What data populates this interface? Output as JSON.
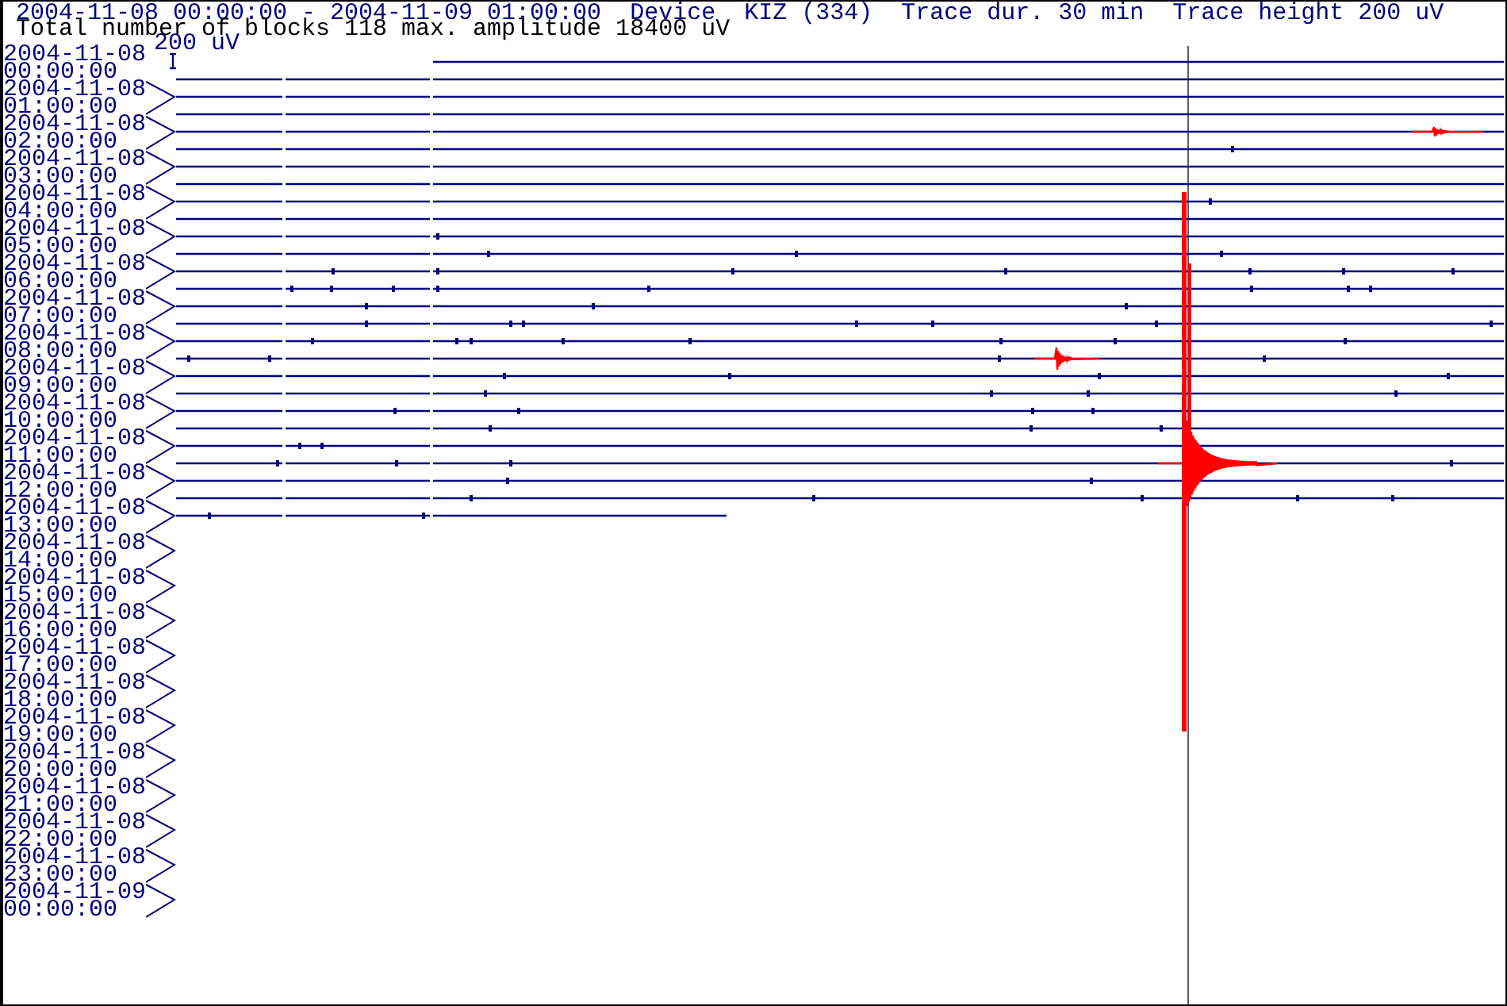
{
  "header": {
    "range": "2004-11-08 00:00:00 - 2004-11-09 01:00:00",
    "device": "Device  KIZ (334)",
    "trace_duration": "Trace dur. 30 min",
    "trace_height": "Trace height 200 uV",
    "summary": "Total number of blocks 118 max. amplitude 18400 uV"
  },
  "scale": {
    "label": "200 uV"
  },
  "time_labels": [
    {
      "date": "2004-11-08",
      "time": "00:00:00"
    },
    {
      "date": "2004-11-08",
      "time": "01:00:00"
    },
    {
      "date": "2004-11-08",
      "time": "02:00:00"
    },
    {
      "date": "2004-11-08",
      "time": "03:00:00"
    },
    {
      "date": "2004-11-08",
      "time": "04:00:00"
    },
    {
      "date": "2004-11-08",
      "time": "05:00:00"
    },
    {
      "date": "2004-11-08",
      "time": "06:00:00"
    },
    {
      "date": "2004-11-08",
      "time": "07:00:00"
    },
    {
      "date": "2004-11-08",
      "time": "08:00:00"
    },
    {
      "date": "2004-11-08",
      "time": "09:00:00"
    },
    {
      "date": "2004-11-08",
      "time": "10:00:00"
    },
    {
      "date": "2004-11-08",
      "time": "11:00:00"
    },
    {
      "date": "2004-11-08",
      "time": "12:00:00"
    },
    {
      "date": "2004-11-08",
      "time": "13:00:00"
    },
    {
      "date": "2004-11-08",
      "time": "14:00:00"
    },
    {
      "date": "2004-11-08",
      "time": "15:00:00"
    },
    {
      "date": "2004-11-08",
      "time": "16:00:00"
    },
    {
      "date": "2004-11-08",
      "time": "17:00:00"
    },
    {
      "date": "2004-11-08",
      "time": "18:00:00"
    },
    {
      "date": "2004-11-08",
      "time": "19:00:00"
    },
    {
      "date": "2004-11-08",
      "time": "20:00:00"
    },
    {
      "date": "2004-11-08",
      "time": "21:00:00"
    },
    {
      "date": "2004-11-08",
      "time": "22:00:00"
    },
    {
      "date": "2004-11-08",
      "time": "23:00:00"
    },
    {
      "date": "2004-11-09",
      "time": "00:00:00"
    }
  ]
}
